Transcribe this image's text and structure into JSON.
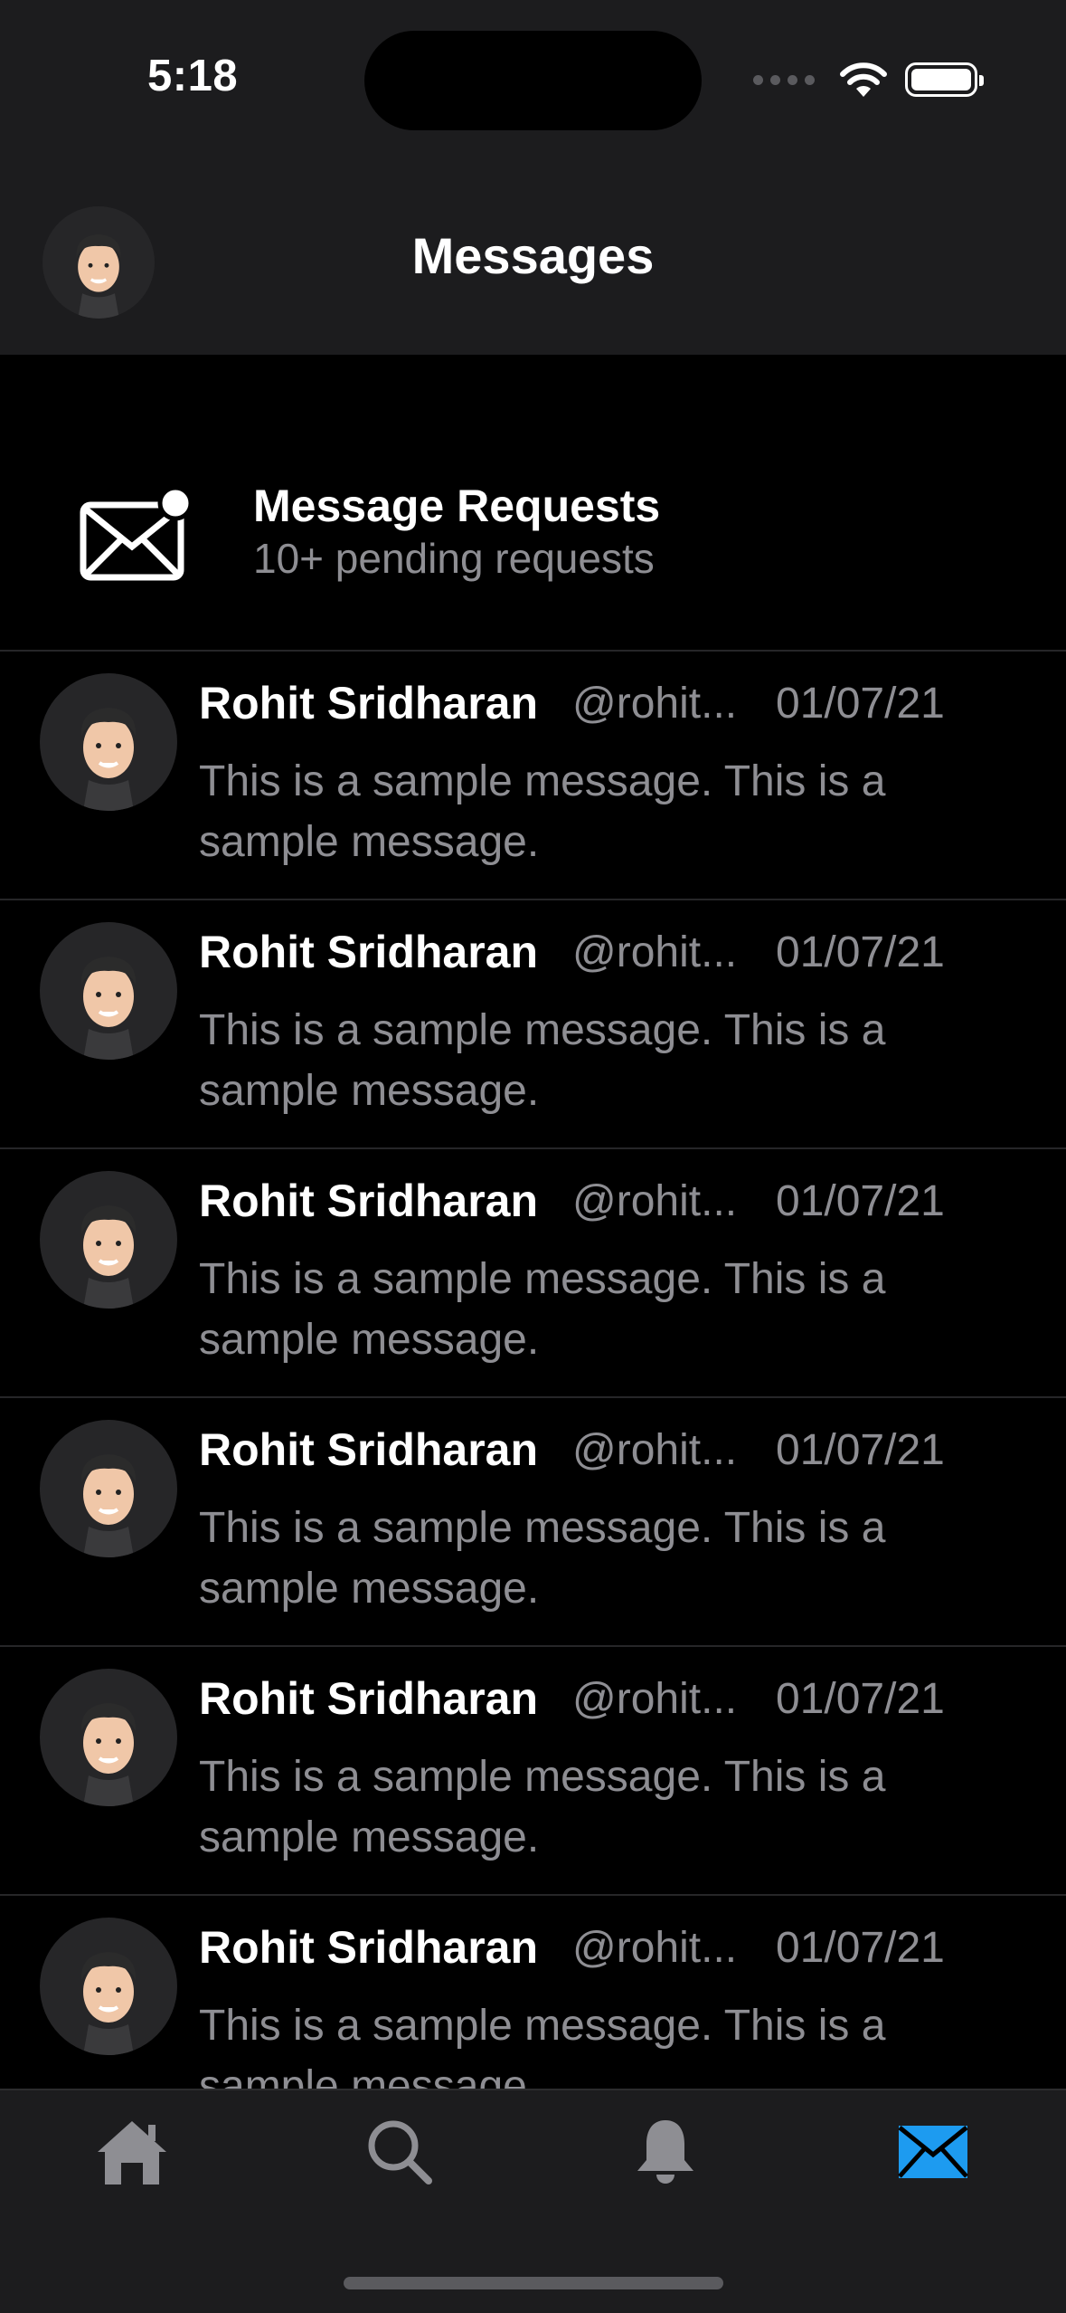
{
  "status_bar": {
    "time": "5:18"
  },
  "nav": {
    "title": "Messages"
  },
  "requests": {
    "title": "Message Requests",
    "subtitle": "10+ pending requests"
  },
  "messages": [
    {
      "name": "Rohit Sridharan",
      "handle": "@rohit...",
      "date": "01/07/21",
      "preview": "This is a sample message. This is a sample message."
    },
    {
      "name": "Rohit Sridharan",
      "handle": "@rohit...",
      "date": "01/07/21",
      "preview": "This is a sample message. This is a sample message."
    },
    {
      "name": "Rohit Sridharan",
      "handle": "@rohit...",
      "date": "01/07/21",
      "preview": "This is a sample message. This is a sample message."
    },
    {
      "name": "Rohit Sridharan",
      "handle": "@rohit...",
      "date": "01/07/21",
      "preview": "This is a sample message. This is a sample message."
    },
    {
      "name": "Rohit Sridharan",
      "handle": "@rohit...",
      "date": "01/07/21",
      "preview": "This is a sample message. This is a sample message."
    },
    {
      "name": "Rohit Sridharan",
      "handle": "@rohit...",
      "date": "01/07/21",
      "preview": "This is a sample message. This is a sample message."
    }
  ],
  "tabbar": {
    "tabs": [
      {
        "icon": "home-icon",
        "active": false
      },
      {
        "icon": "search-icon",
        "active": false
      },
      {
        "icon": "bell-icon",
        "active": false
      },
      {
        "icon": "envelope-icon",
        "active": true
      }
    ],
    "active_color": "#1d9bf0",
    "inactive_color": "#8e8e93"
  }
}
